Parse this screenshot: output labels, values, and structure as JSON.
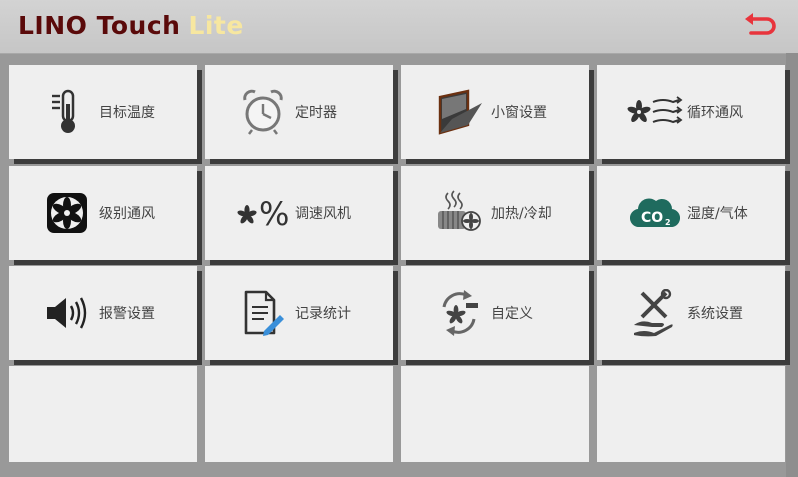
{
  "header": {
    "brand_main": "LINO Touch",
    "brand_suffix": "Lite",
    "back_icon": "back-arrow-icon",
    "back_color": "#e8343c"
  },
  "colors": {
    "brand_main": "#5a0a0a",
    "brand_suffix": "#f7e7a0",
    "tile_bg": "#efefef",
    "co2_badge": "#1f6b5e"
  },
  "menu": [
    {
      "label": "目标温度",
      "icon": "thermometer-icon"
    },
    {
      "label": "定时器",
      "icon": "alarm-clock-icon"
    },
    {
      "label": "小窗设置",
      "icon": "window-icon"
    },
    {
      "label": "循环通风",
      "icon": "circulation-fan-icon"
    },
    {
      "label": "级别通风",
      "icon": "fan-icon"
    },
    {
      "label": "调速风机",
      "icon": "fan-speed-icon"
    },
    {
      "label": "加热/冷却",
      "icon": "heat-cool-icon"
    },
    {
      "label": "湿度/气体",
      "icon": "co2-icon"
    },
    {
      "label": "报警设置",
      "icon": "speaker-icon"
    },
    {
      "label": "记录统计",
      "icon": "document-edit-icon"
    },
    {
      "label": "自定义",
      "icon": "custom-cycle-icon"
    },
    {
      "label": "系统设置",
      "icon": "tools-hand-icon"
    }
  ]
}
